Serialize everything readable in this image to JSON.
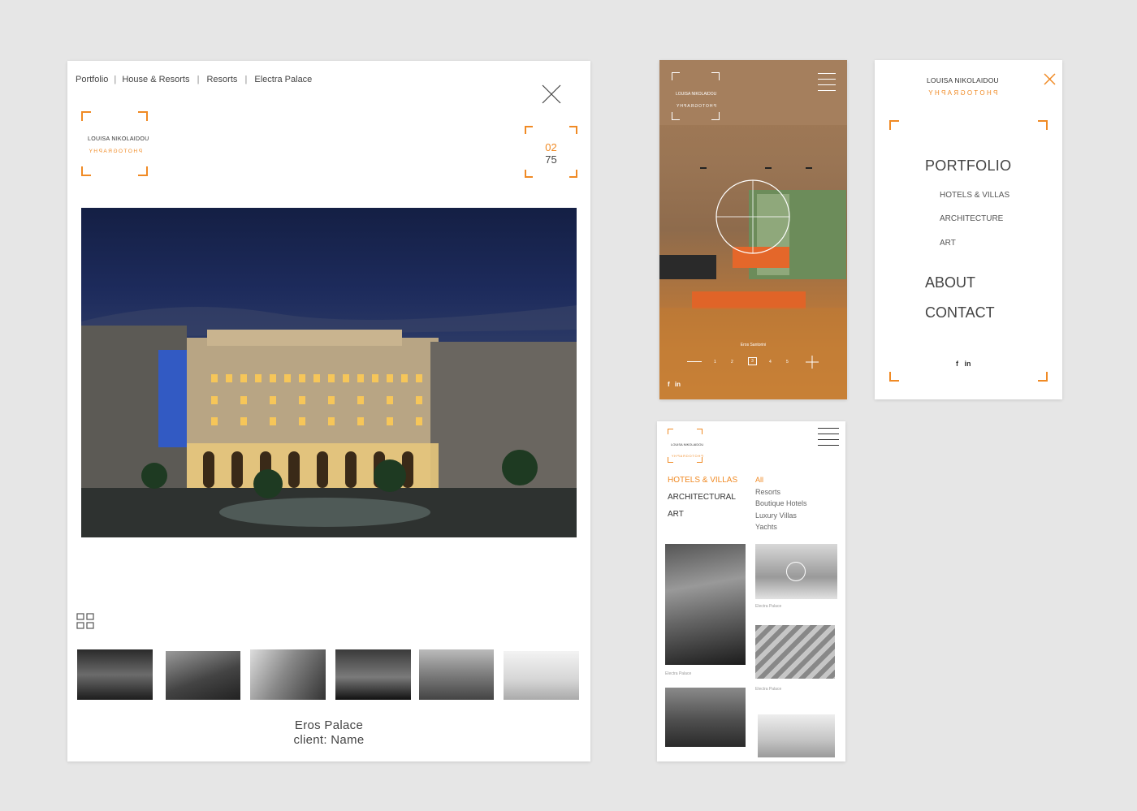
{
  "desktop": {
    "breadcrumb": [
      "Portfolio",
      "House & Resorts",
      "Resorts",
      "Electra Palace"
    ],
    "logo": {
      "line1": "LOUISA NIKOLAIDOU",
      "line2": "PHOTOGRAPHY"
    },
    "counter": {
      "current": "02",
      "total": "75"
    },
    "caption": {
      "title": "Eros Palace",
      "client": "client: Name"
    }
  },
  "mobile_slide": {
    "logo": {
      "line1": "LOUISA NIKOLAIDOU",
      "line2": "PHOTOGRAPHY"
    },
    "caption": "Eros Santorini",
    "pager": [
      "1",
      "2",
      "3",
      "4",
      "5"
    ],
    "social": [
      "f",
      "in"
    ]
  },
  "mobile_menu": {
    "logo": {
      "line1": "LOUISA NIKOLAIDOU",
      "line2": "PHOTOGRAPHY"
    },
    "portfolio": "PORTFOLIO",
    "sub_items": [
      "HOTELS & VILLAS",
      "ARCHITECTURE",
      "ART"
    ],
    "about": "ABOUT",
    "contact": "CONTACT",
    "social": [
      "f",
      "in"
    ]
  },
  "mobile_grid": {
    "logo": {
      "line1": "LOUISA NIKOLAIDOU",
      "line2": "PHOTOGRAPHY"
    },
    "categories": [
      "HOTELS & VILLAS",
      "ARCHITECTURAL",
      "ART"
    ],
    "filters": [
      "All",
      "Resorts",
      "Boutique Hotels",
      "Luxury Villas",
      "Yachts"
    ],
    "thumb_captions": [
      "Electra Palace",
      "Electra Palace",
      "Electra Palace"
    ]
  },
  "colors": {
    "accent": "#f08a24",
    "text": "#444444",
    "background": "#e6e6e6"
  }
}
